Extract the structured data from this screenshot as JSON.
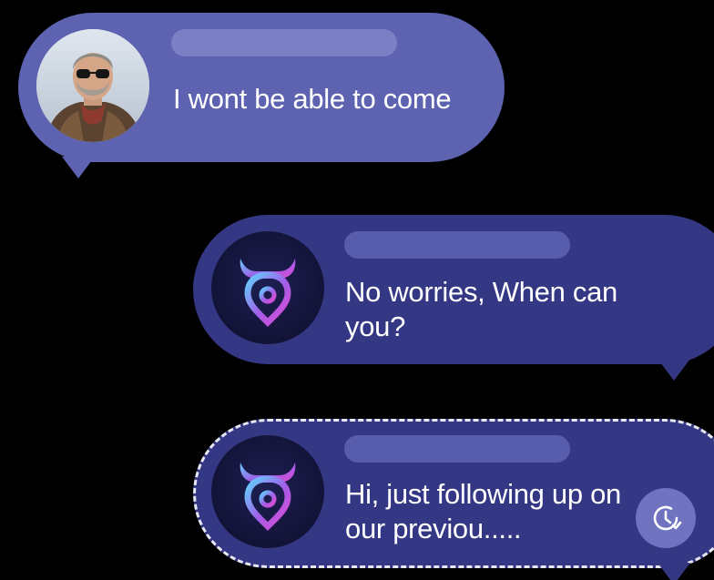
{
  "conversation": {
    "messages": [
      {
        "direction": "incoming",
        "sender_avatar": "user-photo-avatar",
        "text": "I wont be able to come"
      },
      {
        "direction": "outgoing",
        "sender_avatar": "bull-logo-icon",
        "text": "No worries,  When can you?"
      },
      {
        "direction": "outgoing",
        "status": "pending",
        "sender_avatar": "bull-logo-icon",
        "text": "Hi, just following up on our previou.....",
        "status_icon": "clock-check-icon"
      }
    ]
  },
  "colors": {
    "background": "#000000",
    "incoming_bubble": "#5d62b1",
    "outgoing_bubble": "#343783",
    "brand_gradient_start": "#5fd3ff",
    "brand_gradient_end": "#e04bd0"
  }
}
